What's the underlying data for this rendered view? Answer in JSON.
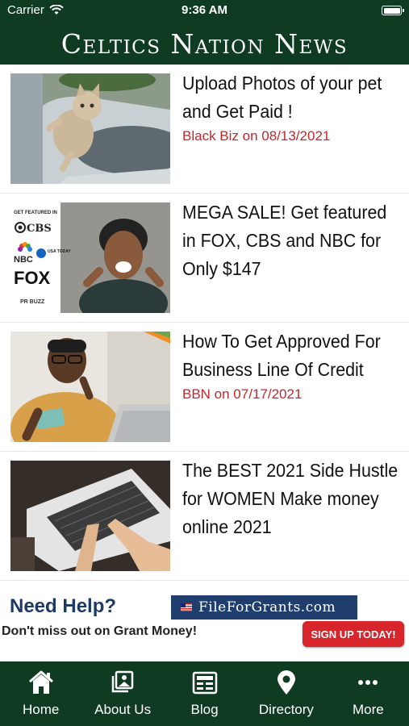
{
  "status_bar": {
    "carrier": "Carrier",
    "time": "9:36 AM"
  },
  "header": {
    "title": "Celtics Nation News"
  },
  "articles": [
    {
      "title": "Upload Photos of your pet and Get Paid !",
      "meta": "Black Biz on 08/13/2021",
      "image": "kitten-on-couch"
    },
    {
      "title": "MEGA SALE! Get featured in FOX, CBS and NBC   for Only $147",
      "meta": "",
      "image": "woman-pointing-media-logos",
      "image_labels": {
        "top": "GET FEATURED IN",
        "cbs": "CBS",
        "nbc": "NBC",
        "usa": "USA TODAY",
        "fox": "FOX",
        "brand": "PR BUZZ"
      }
    },
    {
      "title": "How To Get Approved For Business Line Of Credit",
      "meta": "BBN on 07/17/2021",
      "image": "man-with-credit-card"
    },
    {
      "title": "The BEST 2021 Side Hustle for WOMEN Make money online 2021",
      "meta": "",
      "image": "hands-on-laptop"
    }
  ],
  "ad": {
    "headline": "Need Help?",
    "subtext": "Don't miss out on Grant Money!",
    "logo": "FileForGrants.com",
    "button": "SIGN UP TODAY!"
  },
  "tabs": [
    {
      "label": "Home",
      "icon": "home-icon"
    },
    {
      "label": "About Us",
      "icon": "photos-icon"
    },
    {
      "label": "Blog",
      "icon": "newspaper-icon"
    },
    {
      "label": "Directory",
      "icon": "map-pin-icon"
    },
    {
      "label": "More",
      "icon": "more-icon"
    }
  ],
  "colors": {
    "brand_green": "#0e3b22",
    "meta_red": "#c1272d",
    "ad_button": "#d8252b"
  }
}
